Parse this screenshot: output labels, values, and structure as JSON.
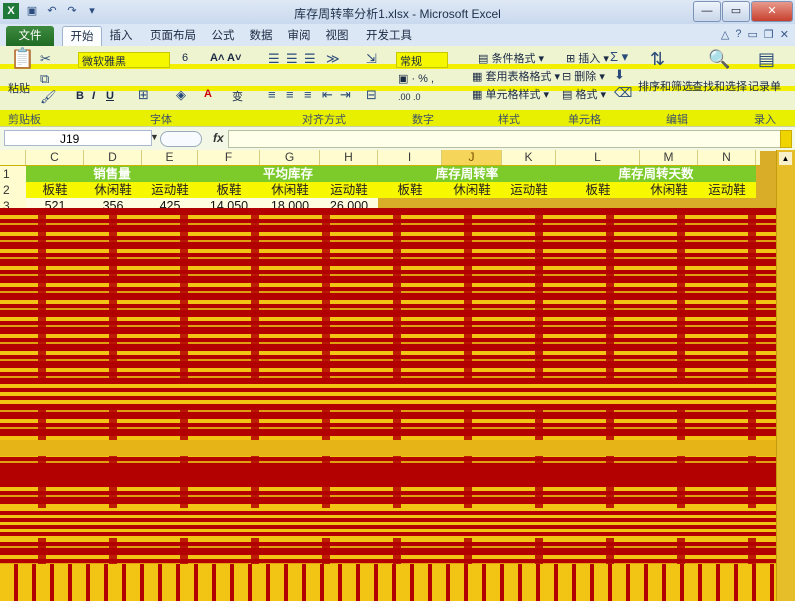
{
  "window": {
    "title": "库存周转率分析1.xlsx - Microsoft Excel"
  },
  "tabs": [
    {
      "label": "文件"
    },
    {
      "label": "开始"
    },
    {
      "label": "插入"
    },
    {
      "label": "页面布局"
    },
    {
      "label": "公式"
    },
    {
      "label": "数据"
    },
    {
      "label": "审阅"
    },
    {
      "label": "视图"
    },
    {
      "label": "开发工具"
    }
  ],
  "ribbon": {
    "paste": "粘贴",
    "font_name": "微软雅黑",
    "number_format": "常规",
    "conditional_format": "条件格式",
    "table_format": "套用表格格式",
    "cell_style": "单元格样式",
    "insert": "插入",
    "delete": "删除",
    "format": "格式",
    "sort_filter": "排序和筛选",
    "find_select": "查找和选择",
    "record": "记录单",
    "groups": [
      "剪贴板",
      "字体",
      "对齐方式",
      "数字",
      "样式",
      "单元格",
      "编辑",
      "录入"
    ]
  },
  "formula_bar": {
    "name_box": "J19",
    "fx": "fx"
  },
  "columns": [
    "C",
    "D",
    "E",
    "F",
    "G",
    "H",
    "I",
    "J",
    "K",
    "L",
    "M",
    "N"
  ],
  "selected_column": "J",
  "rows": [
    "1",
    "2",
    "3"
  ],
  "row1": [
    {
      "text": "销售量"
    },
    {
      "text": "平均库存"
    },
    {
      "text": "库存周转率"
    },
    {
      "text": "库存周转天数"
    }
  ],
  "row2": [
    "板鞋",
    "休闲鞋",
    "运动鞋",
    "板鞋",
    "休闲鞋",
    "运动鞋",
    "板鞋",
    "休闲鞋",
    "运动鞋",
    "板鞋",
    "休闲鞋",
    "运动鞋"
  ],
  "row3": [
    "521",
    "356",
    "425",
    "14,050",
    "18,000",
    "26,000"
  ]
}
